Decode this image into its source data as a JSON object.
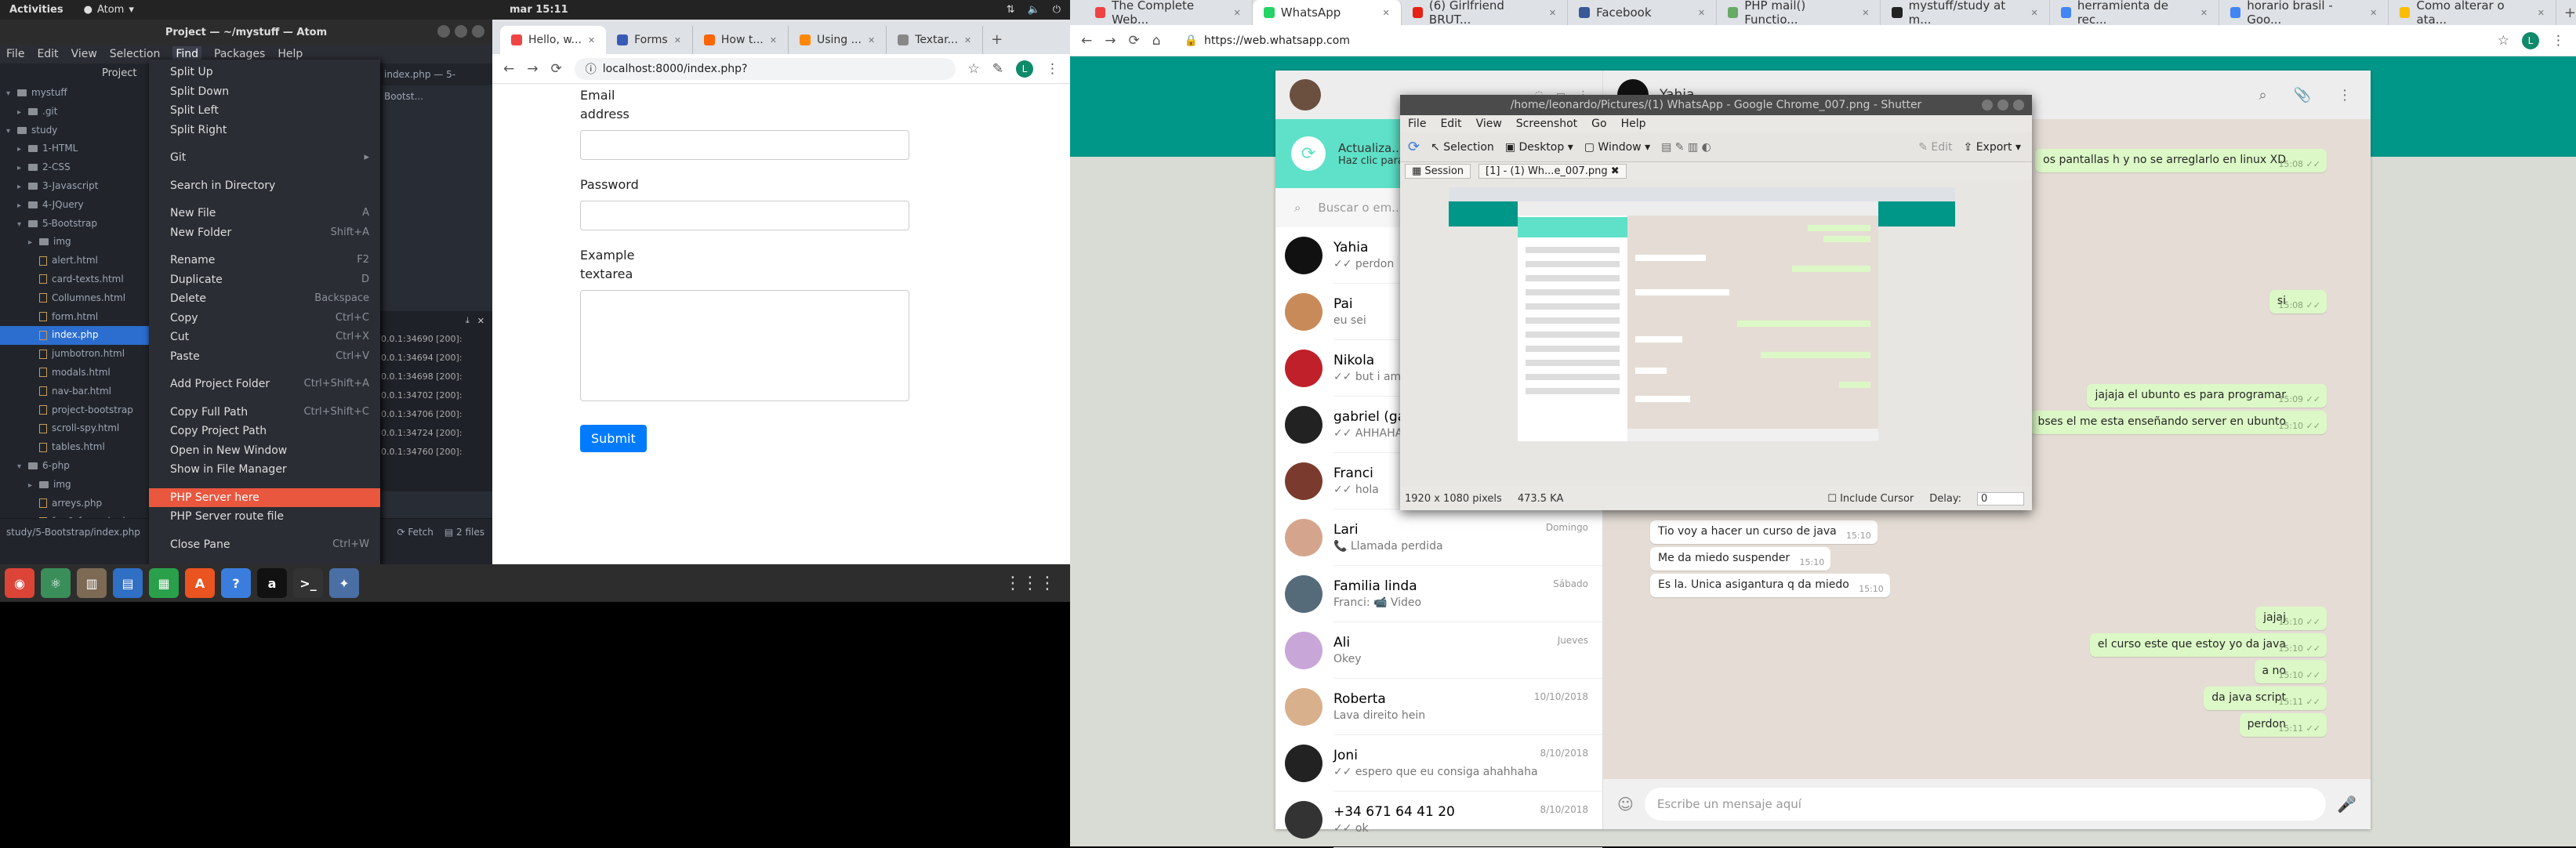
{
  "topbar": {
    "activities": "Activities",
    "app": "Atom",
    "clock": "mar 15:11"
  },
  "atom": {
    "title": "Project — ~/mystuff — Atom",
    "menus": [
      "File",
      "Edit",
      "View",
      "Selection",
      "Find",
      "Packages",
      "Help"
    ],
    "tree_header": "Project",
    "tree": [
      {
        "label": "mystuff",
        "kind": "dir",
        "depth": 0
      },
      {
        "label": ".git",
        "kind": "dir",
        "depth": 1
      },
      {
        "label": "study",
        "kind": "dir",
        "depth": 0
      },
      {
        "label": "1-HTML",
        "kind": "dir",
        "depth": 1
      },
      {
        "label": "2-CSS",
        "kind": "dir",
        "depth": 1
      },
      {
        "label": "3-Javascript",
        "kind": "dir",
        "depth": 1
      },
      {
        "label": "4-JQuery",
        "kind": "dir",
        "depth": 1
      },
      {
        "label": "5-Bootstrap",
        "kind": "dir",
        "depth": 1
      },
      {
        "label": "img",
        "kind": "dir",
        "depth": 2
      },
      {
        "label": "alert.html",
        "kind": "file",
        "depth": 2
      },
      {
        "label": "card-texts.html",
        "kind": "file",
        "depth": 2
      },
      {
        "label": "Collumnes.html",
        "kind": "file",
        "depth": 2
      },
      {
        "label": "form.html",
        "kind": "file",
        "depth": 2
      },
      {
        "label": "index.php",
        "kind": "file",
        "depth": 2,
        "selected": true
      },
      {
        "label": "jumbotron.html",
        "kind": "file",
        "depth": 2
      },
      {
        "label": "modals.html",
        "kind": "file",
        "depth": 2
      },
      {
        "label": "nav-bar.html",
        "kind": "file",
        "depth": 2
      },
      {
        "label": "project-bootstrap",
        "kind": "file",
        "depth": 2
      },
      {
        "label": "scroll-spy.html",
        "kind": "file",
        "depth": 2
      },
      {
        "label": "tables.html",
        "kind": "file",
        "depth": 2
      },
      {
        "label": "6-php",
        "kind": "dir",
        "depth": 1
      },
      {
        "label": "img",
        "kind": "dir",
        "depth": 2
      },
      {
        "label": "arreys.php",
        "kind": "file",
        "depth": 2
      },
      {
        "label": "for-&-foreach.php",
        "kind": "file",
        "depth": 2
      }
    ],
    "editor_tab": "index.php — 5-Bootst...",
    "log_lines": [
      "0.0.1:34690 [200]:",
      "0.0.1:34694 [200]:",
      "0.0.1:34698 [200]:",
      "0.0.1:34702 [200]:",
      "0.0.1:34706 [200]:",
      "0.0.1:34724 [200]:",
      "0.0.1:34760 [200]:"
    ],
    "status_path": "study/5-Bootstrap/index.php",
    "status_fetch": "Fetch",
    "status_files": "2 files",
    "find_menu": [
      {
        "label": "Split Up",
        "shortcut": ""
      },
      {
        "label": "Split Down",
        "shortcut": ""
      },
      {
        "label": "Split Left",
        "shortcut": ""
      },
      {
        "label": "Split Right",
        "shortcut": ""
      },
      {
        "sep": true
      },
      {
        "label": "Git",
        "shortcut": "▸"
      },
      {
        "sep": true
      },
      {
        "label": "Search in Directory",
        "shortcut": ""
      },
      {
        "sep": true
      },
      {
        "label": "New File",
        "shortcut": "A"
      },
      {
        "label": "New Folder",
        "shortcut": "Shift+A"
      },
      {
        "sep": true
      },
      {
        "label": "Rename",
        "shortcut": "F2"
      },
      {
        "label": "Duplicate",
        "shortcut": "D"
      },
      {
        "label": "Delete",
        "shortcut": "Backspace"
      },
      {
        "label": "Copy",
        "shortcut": "Ctrl+C"
      },
      {
        "label": "Cut",
        "shortcut": "Ctrl+X"
      },
      {
        "label": "Paste",
        "shortcut": "Ctrl+V"
      },
      {
        "sep": true
      },
      {
        "label": "Add Project Folder",
        "shortcut": "Ctrl+Shift+A"
      },
      {
        "sep": true
      },
      {
        "label": "Copy Full Path",
        "shortcut": "Ctrl+Shift+C"
      },
      {
        "label": "Copy Project Path",
        "shortcut": ""
      },
      {
        "label": "Open in New Window",
        "shortcut": ""
      },
      {
        "label": "Show in File Manager",
        "shortcut": ""
      },
      {
        "sep": true
      },
      {
        "label": "PHP Server here",
        "shortcut": "",
        "highlight": true
      },
      {
        "label": "PHP Server route file",
        "shortcut": ""
      },
      {
        "sep": true
      },
      {
        "label": "Close Pane",
        "shortcut": "Ctrl+W"
      }
    ]
  },
  "chrome_left": {
    "tabs": [
      "Hello, w...",
      "Forms",
      "How t...",
      "Using ...",
      "Textar..."
    ],
    "url": "localhost:8000/index.php?",
    "form": {
      "email_label_1": "Email",
      "email_label_2": "address",
      "password_label": "Password",
      "textarea_label_1": "Example",
      "textarea_label_2": "textarea",
      "submit": "Submit"
    }
  },
  "chrome_right": {
    "tabs": [
      "The Complete Web...",
      "WhatsApp",
      "(6) Girlfriend BRUT...",
      "Facebook",
      "PHP mail() Functio...",
      "mystuff/study at m...",
      "herramienta de rec...",
      "horario brasil - Goo...",
      "Como alterar o ata..."
    ],
    "url": "https://web.whatsapp.com",
    "whatsapp": {
      "notif_title": "Actualiza...",
      "notif_sub": "Haz clic para...",
      "search_placeholder": "Buscar o em...",
      "header_name": "Yahia",
      "chats": [
        {
          "name": "Yahia",
          "msg": "✓✓ perdon",
          "time": "",
          "color": "#111"
        },
        {
          "name": "Pai",
          "msg": "eu sei",
          "time": "",
          "color": "#c98a5a"
        },
        {
          "name": "Nikola",
          "msg": "✓✓ but i am y...",
          "time": "",
          "color": "#c0202a"
        },
        {
          "name": "gabriel (ga...",
          "msg": "✓✓ AHHAHA...",
          "time": "",
          "color": "#222"
        },
        {
          "name": "Franci",
          "msg": "✓✓ hola",
          "time": "",
          "color": "#7a3b2e"
        },
        {
          "name": "Lari",
          "msg": "📞 Llamada perdida",
          "time": "Domingo",
          "color": "#d4a58c"
        },
        {
          "name": "Familia linda",
          "msg": "Franci: 📹 Video",
          "time": "Sábado",
          "color": "#556b7a"
        },
        {
          "name": "Ali",
          "msg": "Okey",
          "time": "Jueves",
          "color": "#c9a6d8"
        },
        {
          "name": "Roberta",
          "msg": "Lava direito hein",
          "time": "10/10/2018",
          "color": "#d8b08c"
        },
        {
          "name": "Joni",
          "msg": "✓✓ espero que eu consiga ahahhaha",
          "time": "8/10/2018",
          "color": "#222"
        },
        {
          "name": "+34 671 64 41 20",
          "msg": "✓✓ ok",
          "time": "8/10/2018",
          "color": "#333"
        }
      ],
      "messages": [
        {
          "dir": "out",
          "text": "os pantallas h y no se arreglarlo en linux XD",
          "time": "15:08 ✓✓"
        },
        {
          "dir": "out",
          "text": "si",
          "time": "15:08 ✓✓"
        },
        {
          "dir": "out",
          "text": "jajaja el ubunto es para programar",
          "time": "15:09 ✓✓"
        },
        {
          "dir": "out",
          "text": "bses el me esta enseñando server en ubunto",
          "time": "15:10 ✓✓"
        },
        {
          "dir": "in",
          "text": "",
          "time": "15:10"
        },
        {
          "dir": "in",
          "text": "Tio voy a hacer un curso de java",
          "time": "15:10"
        },
        {
          "dir": "in",
          "text": "Me da miedo suspender",
          "time": "15:10"
        },
        {
          "dir": "in",
          "text": "Es la. Unica asigantura q da miedo",
          "time": "15:10"
        },
        {
          "dir": "out",
          "text": "jajaj",
          "time": "15:10 ✓✓"
        },
        {
          "dir": "out",
          "text": "el curso este que estoy yo da java",
          "time": "15:10 ✓✓"
        },
        {
          "dir": "out",
          "text": "a no",
          "time": "15:10 ✓✓"
        },
        {
          "dir": "out",
          "text": "da java script",
          "time": "15:11 ✓✓"
        },
        {
          "dir": "out",
          "text": "perdon",
          "time": "15:11 ✓✓"
        }
      ],
      "compose_placeholder": "Escribe un mensaje aquí"
    }
  },
  "shutter": {
    "title": "/home/leonardo/Pictures/(1) WhatsApp - Google Chrome_007.png - Shutter",
    "menus": [
      "File",
      "Edit",
      "View",
      "Screenshot",
      "Go",
      "Help"
    ],
    "tools": [
      "Selection",
      "Desktop",
      "Window",
      "Edit",
      "Export"
    ],
    "tab_session": "Session",
    "tab_file": "[1] - (1) Wh...e_007.png",
    "status_dims": "1920 x 1080 pixels",
    "status_size": "473.5 KA",
    "include_cursor": "Include Cursor",
    "delay_label": "Delay:",
    "delay_value": "0"
  }
}
